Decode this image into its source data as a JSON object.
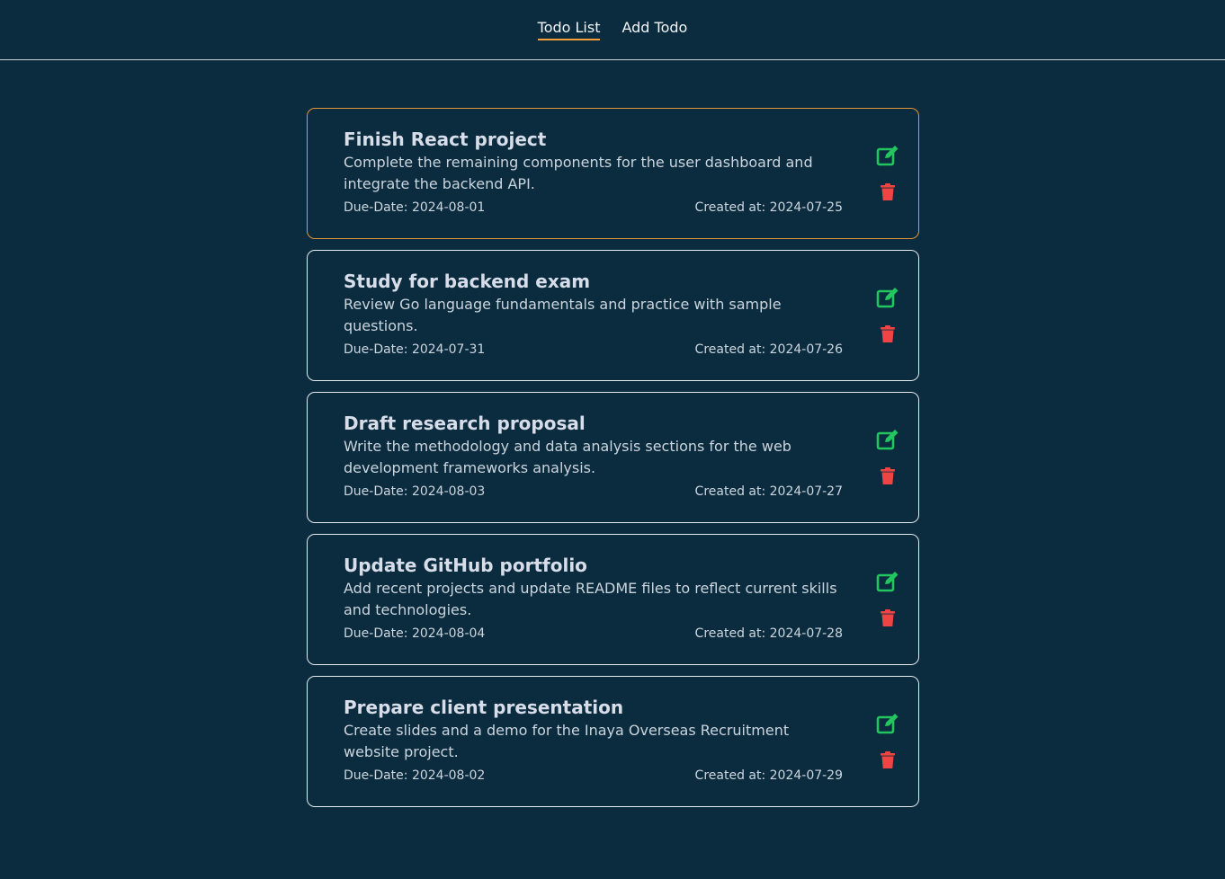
{
  "nav": {
    "items": [
      {
        "label": "Todo List",
        "active": true
      },
      {
        "label": "Add Todo",
        "active": false
      }
    ]
  },
  "colors": {
    "background": "#0b2b3e",
    "accent": "#f5a03a",
    "edit": "#22c55e",
    "delete": "#ef4444"
  },
  "icons": {
    "edit": "edit-icon",
    "delete": "trash-icon"
  },
  "todos": [
    {
      "title": "Finish React project",
      "description": "Complete the remaining components for the user dashboard and integrate the backend API.",
      "due": "Due-Date: 2024-08-01",
      "created": "Created at: 2024-07-25",
      "selected": true
    },
    {
      "title": "Study for backend exam",
      "description": "Review Go language fundamentals and practice with sample questions.",
      "due": "Due-Date: 2024-07-31",
      "created": "Created at: 2024-07-26",
      "selected": false
    },
    {
      "title": "Draft research proposal",
      "description": "Write the methodology and data analysis sections for the web development frameworks analysis.",
      "due": "Due-Date: 2024-08-03",
      "created": "Created at: 2024-07-27",
      "selected": false
    },
    {
      "title": "Update GitHub portfolio",
      "description": "Add recent projects and update README files to reflect current skills and technologies.",
      "due": "Due-Date: 2024-08-04",
      "created": "Created at: 2024-07-28",
      "selected": false
    },
    {
      "title": "Prepare client presentation",
      "description": "Create slides and a demo for the Inaya Overseas Recruitment website project.",
      "due": "Due-Date: 2024-08-02",
      "created": "Created at: 2024-07-29",
      "selected": false
    }
  ]
}
